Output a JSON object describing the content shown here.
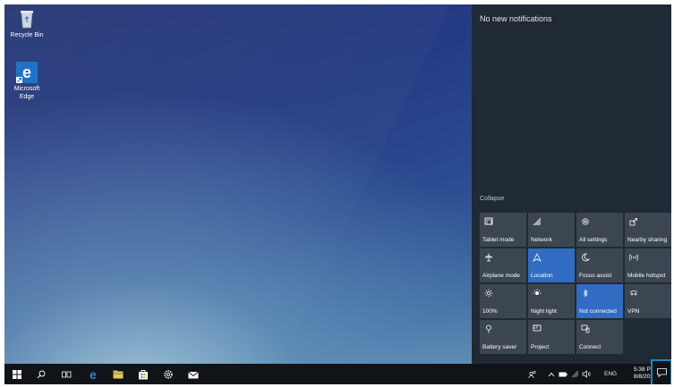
{
  "desktop": {
    "icons": [
      {
        "label": "Recycle Bin"
      },
      {
        "label_line1": "Microsoft",
        "label_line2": "Edge"
      }
    ]
  },
  "action_center": {
    "title": "No new notifications",
    "collapse_label": "Collapse",
    "tiles": [
      {
        "label": "Tablet mode",
        "state": "off",
        "icon": "tablet-icon"
      },
      {
        "label": "Network",
        "state": "off",
        "icon": "network-icon"
      },
      {
        "label": "All settings",
        "state": "off",
        "icon": "gear-icon"
      },
      {
        "label": "Nearby sharing",
        "state": "off",
        "icon": "share-icon"
      },
      {
        "label": "Airplane mode",
        "state": "off",
        "icon": "airplane-icon"
      },
      {
        "label": "Location",
        "state": "on",
        "icon": "location-icon"
      },
      {
        "label": "Focus assist",
        "state": "off",
        "icon": "moon-icon"
      },
      {
        "label": "Mobile hotspot",
        "state": "off",
        "icon": "hotspot-icon"
      },
      {
        "label": "100%",
        "state": "off",
        "icon": "brightness-icon"
      },
      {
        "label": "Night light",
        "state": "off",
        "icon": "night-light-icon"
      },
      {
        "label": "Not connected",
        "state": "on",
        "icon": "bluetooth-icon"
      },
      {
        "label": "VPN",
        "state": "off",
        "icon": "vpn-icon"
      },
      {
        "label": "Battery saver",
        "state": "off",
        "icon": "battery-saver-icon"
      },
      {
        "label": "Project",
        "state": "off",
        "icon": "project-icon"
      },
      {
        "label": "Connect",
        "state": "off",
        "icon": "connect-icon"
      }
    ],
    "accent_color": "#2f6cc2"
  },
  "taskbar": {
    "language": "ENG",
    "time": "5:38 PM",
    "date": "8/8/2019",
    "highlight_color": "#1d86c8"
  }
}
